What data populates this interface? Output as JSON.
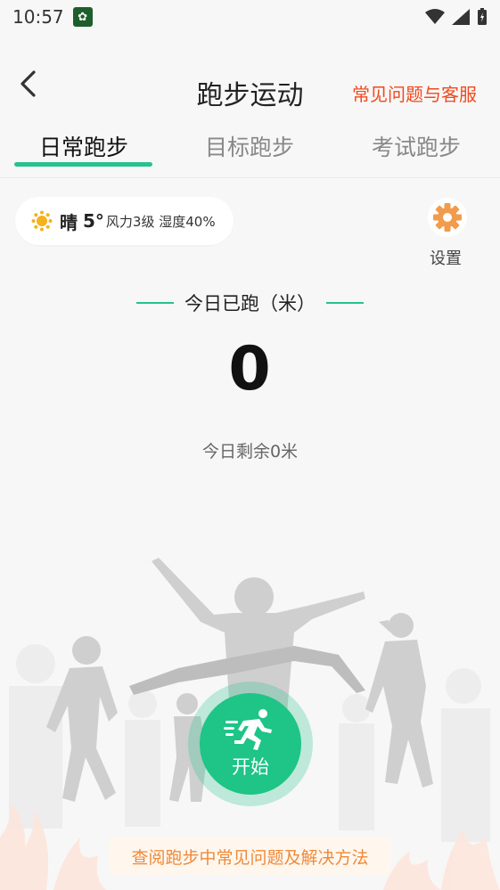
{
  "status_bar": {
    "time": "10:57"
  },
  "nav": {
    "title": "跑步运动",
    "help_link": "常见问题与客服"
  },
  "tabs": [
    {
      "label": "日常跑步",
      "active": true
    },
    {
      "label": "目标跑步",
      "active": false
    },
    {
      "label": "考试跑步",
      "active": false
    }
  ],
  "weather": {
    "icon": "sun-icon",
    "condition": "晴",
    "temperature": "5°",
    "detail": "风力3级 湿度40%"
  },
  "settings": {
    "label": "设置",
    "icon": "gear-icon"
  },
  "today": {
    "header": "今日已跑（米）",
    "distance": "0",
    "remaining": "今日剩余0米"
  },
  "start_button": {
    "label": "开始",
    "icon": "running-person-icon"
  },
  "faq_banner": {
    "text": "查阅跑步中常见问题及解决方法"
  },
  "colors": {
    "accent": "#27c28f",
    "link": "#ef4a1e",
    "gear": "#f19c4c",
    "banner_text": "#ef8a3a"
  }
}
